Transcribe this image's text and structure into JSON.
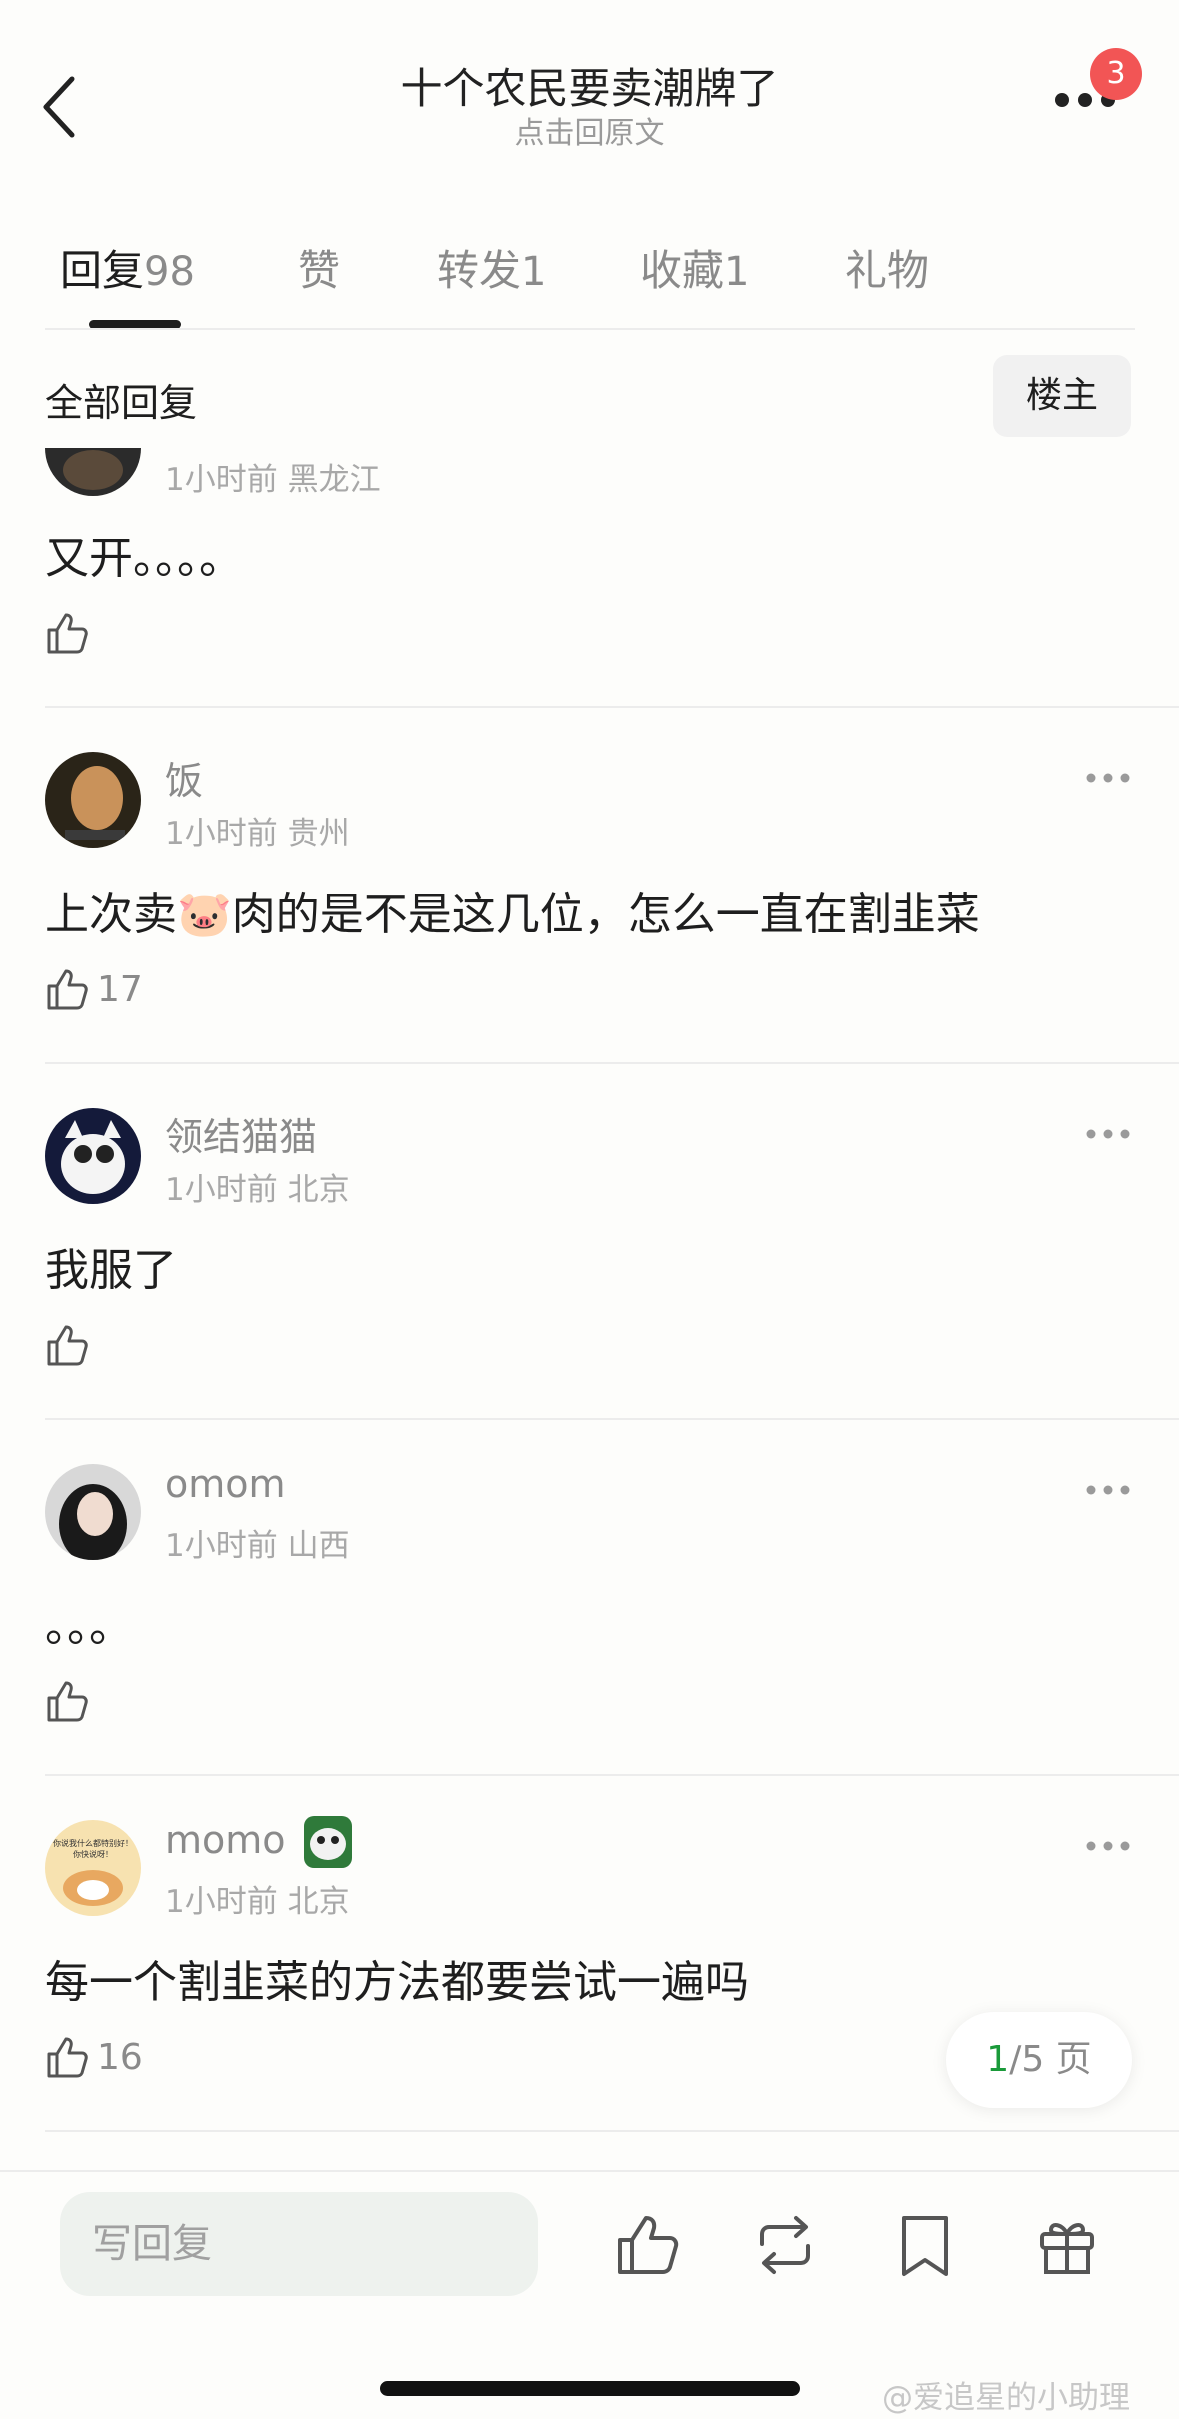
{
  "header": {
    "title": "十个农民要卖潮牌了",
    "subtitle": "点击回原文",
    "notification_count": "3"
  },
  "tabs": [
    {
      "label": "回复",
      "count": "98",
      "active": true
    },
    {
      "label": "赞",
      "count": ""
    },
    {
      "label": "转发",
      "count": "1"
    },
    {
      "label": "收藏",
      "count": "1"
    },
    {
      "label": "礼物",
      "count": ""
    }
  ],
  "filter": {
    "all_label": "全部回复",
    "owner_label": "楼主"
  },
  "comments": [
    {
      "time": "1小时前",
      "location": "黑龙江",
      "text": "又开。。。。",
      "likes": ""
    },
    {
      "username": "饭",
      "time": "1小时前",
      "location": "贵州",
      "text_before": "上次卖",
      "text_emoji": "🐷",
      "text_after": "肉的是不是这几位，怎么一直在割韭菜",
      "likes": "17"
    },
    {
      "username": "领结猫猫",
      "time": "1小时前",
      "location": "北京",
      "text": "我服了",
      "likes": ""
    },
    {
      "username": "omom",
      "time": "1小时前",
      "location": "山西",
      "text": "。。。",
      "likes": ""
    },
    {
      "username": "momo",
      "time": "1小时前",
      "location": "北京",
      "text": "每一个割韭菜的方法都要尝试一遍吗",
      "likes": "16",
      "avatar_text_1": "你说我什么都特别好！",
      "avatar_text_2": "你快说呀！"
    }
  ],
  "pager": {
    "current": "1",
    "total_text": "/5 页"
  },
  "bottom_bar": {
    "reply_placeholder": "写回复"
  },
  "watermark": "@爱追星的小助理",
  "colors": {
    "accent_green": "#1a9a3a",
    "badge_red": "#f25555",
    "text_gray": "#8a8a8a"
  },
  "icons": [
    "back-icon",
    "more-icon",
    "thumb-up-icon",
    "repost-icon",
    "bookmark-icon",
    "gift-icon"
  ]
}
